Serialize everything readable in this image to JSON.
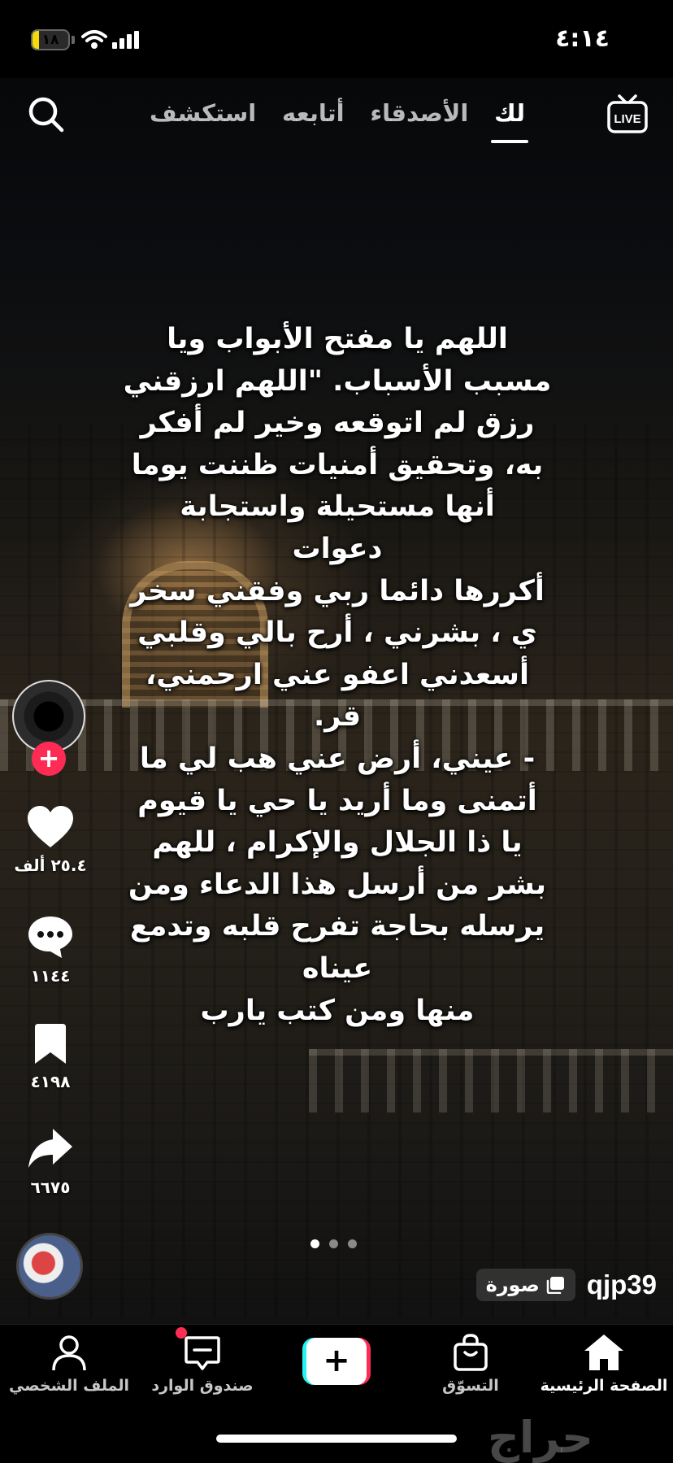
{
  "status_bar": {
    "time": "٤:١٤",
    "battery_level": "١٨",
    "battery_percent": 18
  },
  "top_nav": {
    "tabs": [
      {
        "label": "استكشف",
        "active": false
      },
      {
        "label": "أتابعه",
        "active": false
      },
      {
        "label": "الأصدقاء",
        "active": false
      },
      {
        "label": "لك",
        "active": true
      }
    ],
    "live_label": "LIVE",
    "search_icon": "search-icon"
  },
  "caption": "اللهم يا مفتح الأبواب ويا\nمسبب الأسباب. \"اللهم ارزقني\nرزق لم اتوقعه وخير لم أفكر\nبه، وتحقيق أمنيات ظننت يوما\nأنها مستحيلة واستجابة\nدعوات\nأكررها دائما ربي وفقني سخر\nي ، بشرني ، أرح بالي وقلبي\nأسعدني اعفو عني ارحمني،\nقر.\n- عيني، أرض عني هب لي ما\nأتمنى وما أريد يا حي يا قيوم\nيا ذا الجلال والإكرام ، للهم\nبشر من أرسل هذا الدعاء ومن\nيرسله بحاجة تفرح قلبه وتدمع\nعيناه\nمنها ومن كتب يارب",
  "rail": {
    "follow_plus": "+",
    "likes": "٢٥.٤ ألف",
    "comments": "١١٤٤",
    "saves": "٤١٩٨",
    "shares": "٦٦٧٥"
  },
  "post": {
    "username": "qjp39",
    "type_badge": "صورة",
    "pages": [
      true,
      false,
      false
    ]
  },
  "bottom_nav": {
    "home": "الصفحة الرئيسية",
    "shop": "التسوّق",
    "create": "+",
    "inbox": "صندوق الوارد",
    "profile": "الملف الشخصي"
  },
  "watermark": "حراج",
  "colors": {
    "accent_red": "#fe2c55",
    "accent_cyan": "#25f4ee",
    "battery_yellow": "#f5d90a"
  }
}
